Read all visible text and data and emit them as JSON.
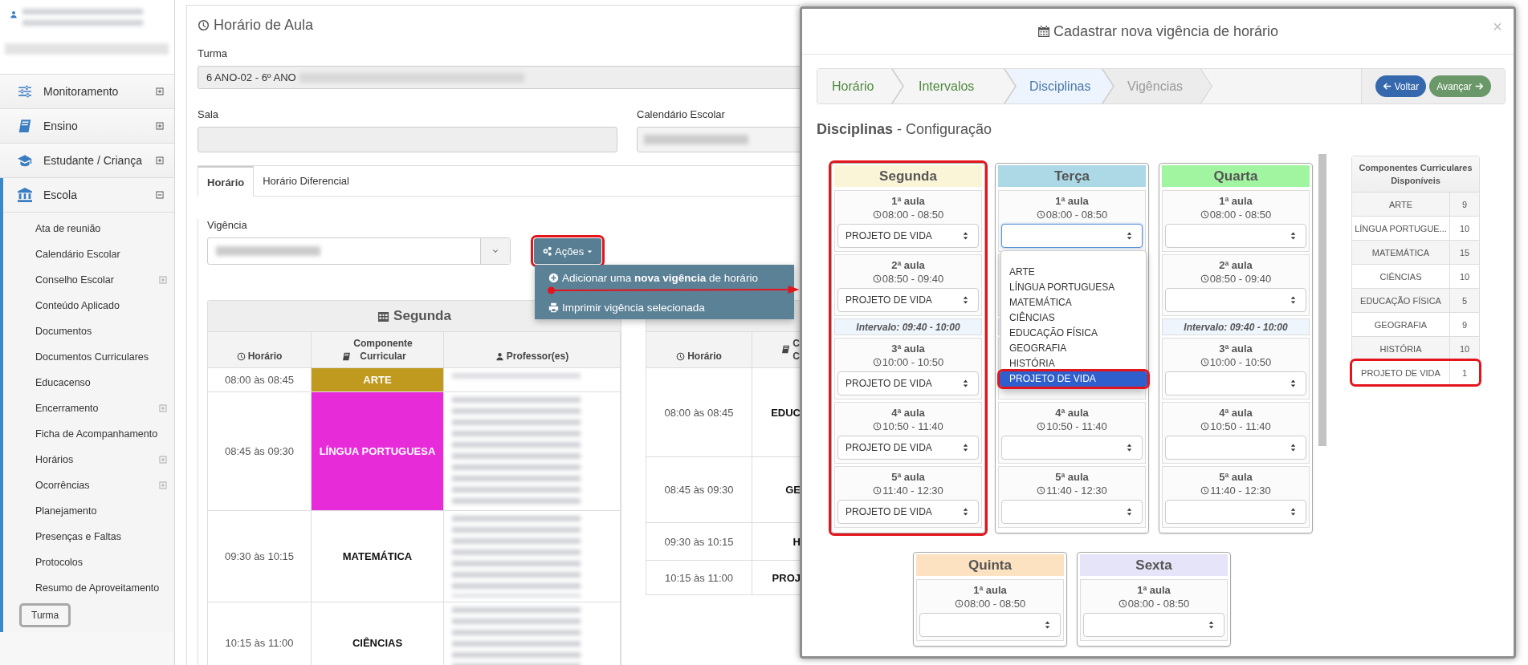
{
  "sidebar": {
    "menu": [
      {
        "label": "Monitoramento",
        "expanded": false
      },
      {
        "label": "Ensino",
        "expanded": false
      },
      {
        "label": "Estudante / Criança",
        "expanded": false
      },
      {
        "label": "Escola",
        "expanded": true,
        "children": [
          {
            "label": "Ata de reunião",
            "expandable": false,
            "selected": false
          },
          {
            "label": "Calendário Escolar",
            "expandable": false,
            "selected": false
          },
          {
            "label": "Conselho Escolar",
            "expandable": true,
            "selected": false
          },
          {
            "label": "Conteúdo Aplicado",
            "expandable": false,
            "selected": false
          },
          {
            "label": "Documentos",
            "expandable": false,
            "selected": false
          },
          {
            "label": "Documentos Curriculares",
            "expandable": false,
            "selected": false
          },
          {
            "label": "Educacenso",
            "expandable": false,
            "selected": false
          },
          {
            "label": "Encerramento",
            "expandable": true,
            "selected": false
          },
          {
            "label": "Ficha de Acompanhamento",
            "expandable": false,
            "selected": false
          },
          {
            "label": "Horários",
            "expandable": true,
            "selected": false
          },
          {
            "label": "Ocorrências",
            "expandable": true,
            "selected": false
          },
          {
            "label": "Planejamento",
            "expandable": false,
            "selected": false
          },
          {
            "label": "Presenças e Faltas",
            "expandable": false,
            "selected": false
          },
          {
            "label": "Protocolos",
            "expandable": false,
            "selected": false
          },
          {
            "label": "Resumo de Aproveitamento",
            "expandable": false,
            "selected": false
          },
          {
            "label": "Turma",
            "expandable": false,
            "selected": true
          }
        ]
      }
    ]
  },
  "page": {
    "title": "Horário de Aula",
    "turma": {
      "label": "Turma",
      "value": "6 ANO-02 - 6º ANO"
    },
    "sala": {
      "label": "Sala"
    },
    "calendario": {
      "label": "Calendário Escolar"
    },
    "tabs": [
      {
        "label": "Horário",
        "selected": true
      },
      {
        "label": "Horário Diferencial",
        "selected": false
      }
    ],
    "vigencia": {
      "label": "Vigência"
    },
    "actions": {
      "label": "Ações",
      "highlighted": true,
      "menu": [
        {
          "text": "Adicionar uma **nova vigência** de horário"
        },
        {
          "text": "Imprimir vigência selecionada"
        }
      ]
    },
    "tables": [
      {
        "day": "Segunda",
        "columns": [
          "Horário",
          "Componente\nCurricular",
          "Professor(es)"
        ],
        "rows": [
          {
            "time": "08:00 às 08:45",
            "component": "ARTE",
            "color": "#bf9a1f"
          },
          {
            "time": "08:45 às 09:30",
            "component": "LÍNGUA PORTUGUESA",
            "color": "#e82bd9"
          },
          {
            "time": "09:30 às 10:15",
            "component": "MATEMÁTICA"
          },
          {
            "time": "10:15 às 11:00",
            "component": "CIÊNCIAS"
          }
        ]
      },
      {
        "columns": [
          "Horário",
          "C\nC"
        ],
        "rows": [
          {
            "time": "08:00 às 08:45",
            "component": "EDUC"
          },
          {
            "time": "08:45 às 09:30",
            "component": "GE"
          },
          {
            "time": "09:30 às 10:15",
            "component": "H"
          },
          {
            "time": "10:15 às 11:00",
            "component": "PROJ"
          }
        ]
      }
    ]
  },
  "modal": {
    "title": "Cadastrar nova vigência de horário",
    "close": "×",
    "steps": [
      {
        "label": "Horário",
        "visited": true,
        "selected": false
      },
      {
        "label": "Intervalos",
        "visited": true,
        "selected": false
      },
      {
        "label": "Disciplinas",
        "visited": true,
        "selected": true
      },
      {
        "label": "Vigências",
        "visited": false,
        "selected": false
      }
    ],
    "buttons": [
      {
        "label": "Voltar",
        "kind": "back"
      },
      {
        "label": "Avançar",
        "kind": "next"
      }
    ],
    "heading": "**Disciplinas** - Configuração",
    "days": [
      {
        "name": "Segunda",
        "color": "#fbf5d8",
        "highlighted": true,
        "slots": [
          {
            "kind": "lesson",
            "title": "1ª aula",
            "time": "08:00 - 08:50",
            "value": "PROJETO DE VIDA",
            "focused": false
          },
          {
            "kind": "lesson",
            "title": "2ª aula",
            "time": "08:50 - 09:40",
            "value": "PROJETO DE VIDA",
            "focused": false
          },
          {
            "kind": "break",
            "text": "Intervalo: 09:40 - 10:00"
          },
          {
            "kind": "lesson",
            "title": "3ª aula",
            "time": "10:00 - 10:50",
            "value": "PROJETO DE VIDA",
            "focused": false
          },
          {
            "kind": "lesson",
            "title": "4ª aula",
            "time": "10:50 - 11:40",
            "value": "PROJETO DE VIDA",
            "focused": false
          },
          {
            "kind": "lesson",
            "title": "5ª aula",
            "time": "11:40 - 12:30",
            "value": "PROJETO DE VIDA",
            "focused": false
          }
        ]
      },
      {
        "name": "Terça",
        "color": "#add8e6",
        "highlighted": false,
        "slots": [
          {
            "kind": "lesson",
            "title": "1ª aula",
            "time": "08:00 - 08:50",
            "focused": true,
            "options": [
              {
                "label": "ARTE",
                "selected": false
              },
              {
                "label": "LÍNGUA PORTUGUESA",
                "selected": false
              },
              {
                "label": "MATEMÁTICA",
                "selected": false
              },
              {
                "label": "CIÊNCIAS",
                "selected": false
              },
              {
                "label": "EDUCAÇÃO FÍSICA",
                "selected": false
              },
              {
                "label": "GEOGRAFIA",
                "selected": false
              },
              {
                "label": "HISTÓRIA",
                "selected": false
              },
              {
                "label": "PROJETO DE VIDA",
                "selected": true
              }
            ]
          },
          {
            "kind": "covered"
          },
          {
            "kind": "covered_break"
          },
          {
            "kind": "covered"
          },
          {
            "kind": "lesson",
            "title": "4ª aula",
            "time": "10:50 - 11:40",
            "focused": false
          },
          {
            "kind": "lesson",
            "title": "5ª aula",
            "time": "11:40 - 12:30",
            "focused": false
          }
        ]
      },
      {
        "name": "Quarta",
        "color": "#a1f5a1",
        "highlighted": false,
        "slots": [
          {
            "kind": "lesson",
            "title": "1ª aula",
            "time": "08:00 - 08:50",
            "focused": false
          },
          {
            "kind": "lesson",
            "title": "2ª aula",
            "time": "08:50 - 09:40",
            "focused": false
          },
          {
            "kind": "break",
            "text": "Intervalo: 09:40 - 10:00"
          },
          {
            "kind": "lesson",
            "title": "3ª aula",
            "time": "10:00 - 10:50",
            "focused": false
          },
          {
            "kind": "lesson",
            "title": "4ª aula",
            "time": "10:50 - 11:40",
            "focused": false
          },
          {
            "kind": "lesson",
            "title": "5ª aula",
            "time": "11:40 - 12:30",
            "focused": false
          }
        ]
      },
      {
        "name": "Quinta",
        "color": "#fce2c0",
        "highlighted": false,
        "slots": [
          {
            "kind": "lesson",
            "title": "1ª aula",
            "time": "08:00 - 08:50",
            "focused": false
          }
        ]
      },
      {
        "name": "Sexta",
        "color": "#e6e4f8",
        "highlighted": false,
        "slots": [
          {
            "kind": "lesson",
            "title": "1ª aula",
            "time": "08:00 - 08:50",
            "focused": false
          }
        ]
      }
    ],
    "components": {
      "title": "Componentes Curriculares Disponíveis",
      "rows": [
        {
          "name": "ARTE",
          "count": "9",
          "highlighted": false
        },
        {
          "name": "LÍNGUA PORTUGUE...",
          "count": "10",
          "highlighted": false
        },
        {
          "name": "MATEMÁTICA",
          "count": "15",
          "highlighted": false
        },
        {
          "name": "CIÊNCIAS",
          "count": "10",
          "highlighted": false
        },
        {
          "name": "EDUCAÇÃO FÍSICA",
          "count": "5",
          "highlighted": false
        },
        {
          "name": "GEOGRAFIA",
          "count": "9",
          "highlighted": false
        },
        {
          "name": "HISTÓRIA",
          "count": "10",
          "highlighted": false
        },
        {
          "name": "PROJETO DE VIDA",
          "count": "1",
          "highlighted": true
        }
      ]
    }
  }
}
